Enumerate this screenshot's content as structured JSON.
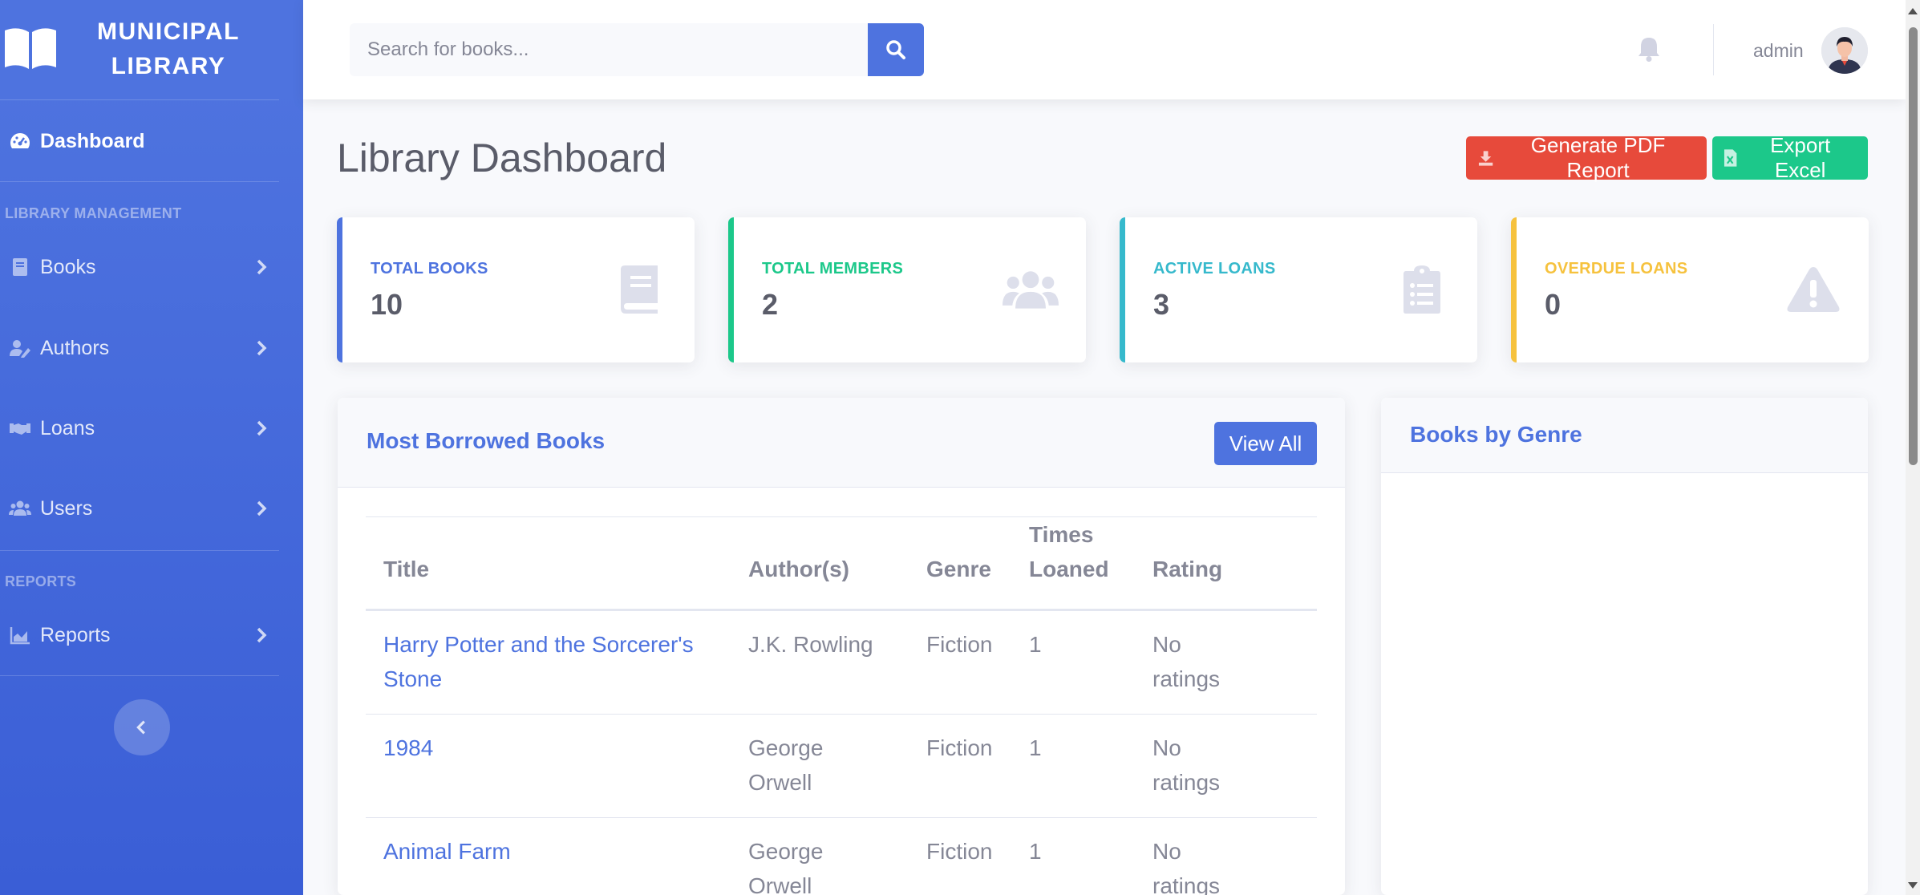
{
  "brand": {
    "line1": "MUNICIPAL",
    "line2": "LIBRARY"
  },
  "sidebar": {
    "dashboard_label": "Dashboard",
    "section_management": "LIBRARY MANAGEMENT",
    "items": [
      {
        "label": "Books"
      },
      {
        "label": "Authors"
      },
      {
        "label": "Loans"
      },
      {
        "label": "Users"
      }
    ],
    "section_reports": "REPORTS",
    "reports_label": "Reports"
  },
  "topbar": {
    "search_placeholder": "Search for books...",
    "user_name": "admin"
  },
  "page": {
    "title": "Library Dashboard",
    "pdf_button": "Generate PDF Report",
    "excel_button": "Export Excel"
  },
  "stats": [
    {
      "label": "TOTAL BOOKS",
      "value": "10",
      "color": "#4e73df",
      "icon": "book-icon"
    },
    {
      "label": "TOTAL MEMBERS",
      "value": "2",
      "color": "#1cc88a",
      "icon": "users-icon"
    },
    {
      "label": "ACTIVE LOANS",
      "value": "3",
      "color": "#36b9cc",
      "icon": "clipboard-list-icon"
    },
    {
      "label": "OVERDUE LOANS",
      "value": "0",
      "color": "#f6c23e",
      "icon": "warning-icon"
    }
  ],
  "most_borrowed": {
    "title": "Most Borrowed Books",
    "view_all": "View All",
    "columns": [
      "Title",
      "Author(s)",
      "Genre",
      "Times Loaned",
      "Rating"
    ],
    "rows": [
      {
        "title": "Harry Potter and the Sorcerer's Stone",
        "author": "J.K. Rowling",
        "genre": "Fiction",
        "times": "1",
        "rating": "No ratings"
      },
      {
        "title": "1984",
        "author": "George Orwell",
        "genre": "Fiction",
        "times": "1",
        "rating": "No ratings"
      },
      {
        "title": "Animal Farm",
        "author": "George Orwell",
        "genre": "Fiction",
        "times": "1",
        "rating": "No ratings"
      }
    ]
  },
  "genre_card": {
    "title": "Books by Genre"
  },
  "colors": {
    "primary": "#4e73df",
    "danger": "#e74a3b",
    "success": "#1cc88a",
    "info": "#36b9cc",
    "warning": "#f6c23e"
  }
}
